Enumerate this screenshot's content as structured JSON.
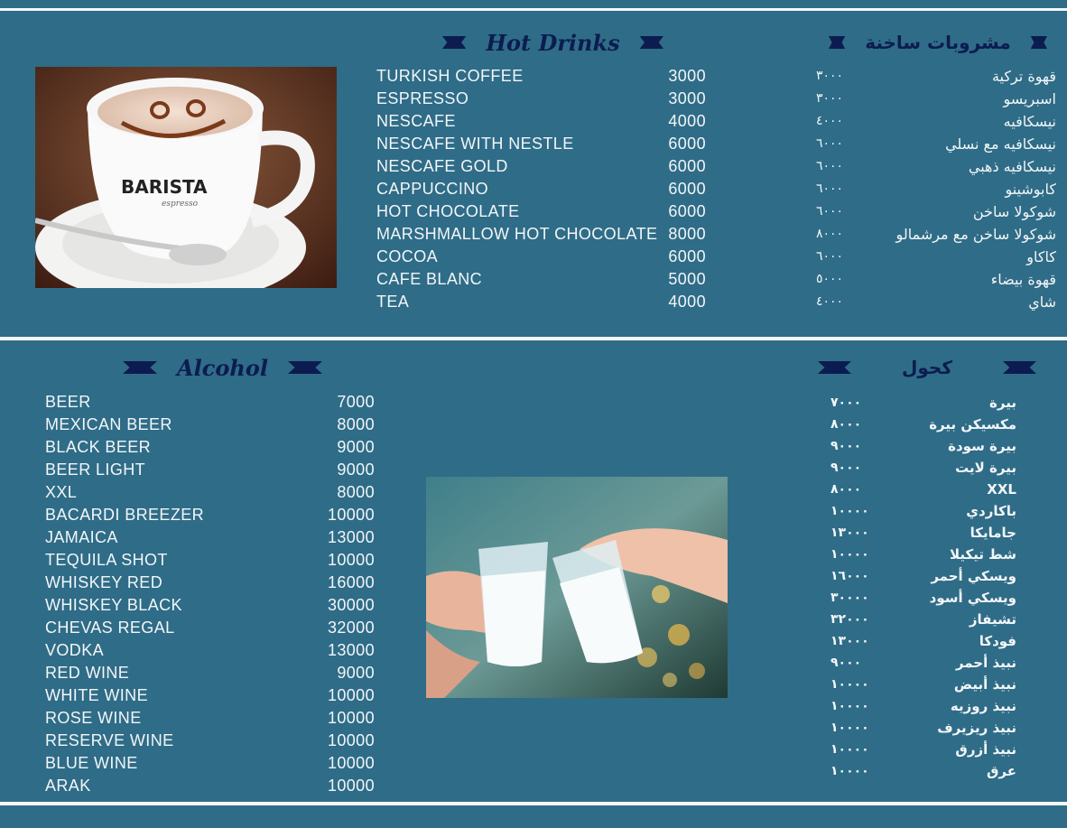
{
  "hot": {
    "title_en": "Hot Drinks",
    "title_ar": "مشروبات ساخنة",
    "items_en": [
      {
        "name": "TURKISH COFFEE",
        "price": "3000"
      },
      {
        "name": "ESPRESSO",
        "price": "3000"
      },
      {
        "name": "NESCAFE",
        "price": "4000"
      },
      {
        "name": "NESCAFE WITH NESTLE",
        "price": "6000"
      },
      {
        "name": "NESCAFE GOLD",
        "price": "6000"
      },
      {
        "name": "CAPPUCCINO",
        "price": "6000"
      },
      {
        "name": "HOT CHOCOLATE",
        "price": "6000"
      },
      {
        "name": "MARSHMALLOW HOT CHOCOLATE",
        "price": "8000"
      },
      {
        "name": "COCOA",
        "price": "6000"
      },
      {
        "name": "CAFE BLANC",
        "price": "5000"
      },
      {
        "name": "TEA",
        "price": "4000"
      }
    ],
    "items_ar": [
      {
        "name": "قهوة تركية",
        "price": "٣٠٠٠"
      },
      {
        "name": "اسبريسو",
        "price": "٣٠٠٠"
      },
      {
        "name": "نيسكافيه",
        "price": "٤٠٠٠"
      },
      {
        "name": "نيسكافيه مع نسلي",
        "price": "٦٠٠٠"
      },
      {
        "name": "نيسكافيه ذهبي",
        "price": "٦٠٠٠"
      },
      {
        "name": "كابوشينو",
        "price": "٦٠٠٠"
      },
      {
        "name": "شوكولا ساخن",
        "price": "٦٠٠٠"
      },
      {
        "name": "شوكولا ساخن مع مرشمالو",
        "price": "٨٠٠٠"
      },
      {
        "name": "كاكاو",
        "price": "٦٠٠٠"
      },
      {
        "name": "قهوة بيضاء",
        "price": "٥٠٠٠"
      },
      {
        "name": "شاي",
        "price": "٤٠٠٠"
      }
    ],
    "cup_brand": "BARISTA",
    "cup_sub": "espresso"
  },
  "alcohol": {
    "title_en": "Alcohol",
    "title_ar": "كحول",
    "items_en": [
      {
        "name": "BEER",
        "price": "7000"
      },
      {
        "name": "MEXICAN BEER",
        "price": "8000"
      },
      {
        "name": "BLACK BEER",
        "price": "9000"
      },
      {
        "name": "BEER LIGHT",
        "price": "9000"
      },
      {
        "name": "XXL",
        "price": "8000"
      },
      {
        "name": "BACARDI BREEZER",
        "price": "10000"
      },
      {
        "name": "JAMAICA",
        "price": "13000"
      },
      {
        "name": "TEQUILA SHOT",
        "price": "10000"
      },
      {
        "name": "WHISKEY RED",
        "price": "16000"
      },
      {
        "name": "WHISKEY BLACK",
        "price": "30000"
      },
      {
        "name": "CHEVAS REGAL",
        "price": "32000"
      },
      {
        "name": "VODKA",
        "price": "13000"
      },
      {
        "name": "RED WINE",
        "price": "9000"
      },
      {
        "name": "WHITE WINE",
        "price": "10000"
      },
      {
        "name": "ROSE WINE",
        "price": "10000"
      },
      {
        "name": "RESERVE WINE",
        "price": "10000"
      },
      {
        "name": "BLUE WINE",
        "price": "10000"
      },
      {
        "name": "ARAK",
        "price": "10000"
      }
    ],
    "items_ar": [
      {
        "name": "بيرة",
        "price": "٧٠٠٠"
      },
      {
        "name": "مكسيكن بيرة",
        "price": "٨٠٠٠"
      },
      {
        "name": "بيرة سودة",
        "price": "٩٠٠٠"
      },
      {
        "name": "بيرة لايت",
        "price": "٩٠٠٠"
      },
      {
        "name": "XXL",
        "price": "٨٠٠٠"
      },
      {
        "name": "باكاردي",
        "price": "١٠٠٠٠"
      },
      {
        "name": "جامايكا",
        "price": "١٣٠٠٠"
      },
      {
        "name": "شط تيكيلا",
        "price": "١٠٠٠٠"
      },
      {
        "name": "ويسكي أحمر",
        "price": "١٦٠٠٠"
      },
      {
        "name": "ويسكي أسود",
        "price": "٣٠٠٠٠"
      },
      {
        "name": "تشيفاز",
        "price": "٣٢٠٠٠"
      },
      {
        "name": "فودكا",
        "price": "١٣٠٠٠"
      },
      {
        "name": "نبيذ أحمر",
        "price": "٩٠٠٠"
      },
      {
        "name": "نبيذ أبيض",
        "price": "١٠٠٠٠"
      },
      {
        "name": "نبيذ روزيه",
        "price": "١٠٠٠٠"
      },
      {
        "name": "نبيذ ريزيرف",
        "price": "١٠٠٠٠"
      },
      {
        "name": "نبيذ أزرق",
        "price": "١٠٠٠٠"
      },
      {
        "name": "عرق",
        "price": "١٠٠٠٠"
      }
    ]
  }
}
